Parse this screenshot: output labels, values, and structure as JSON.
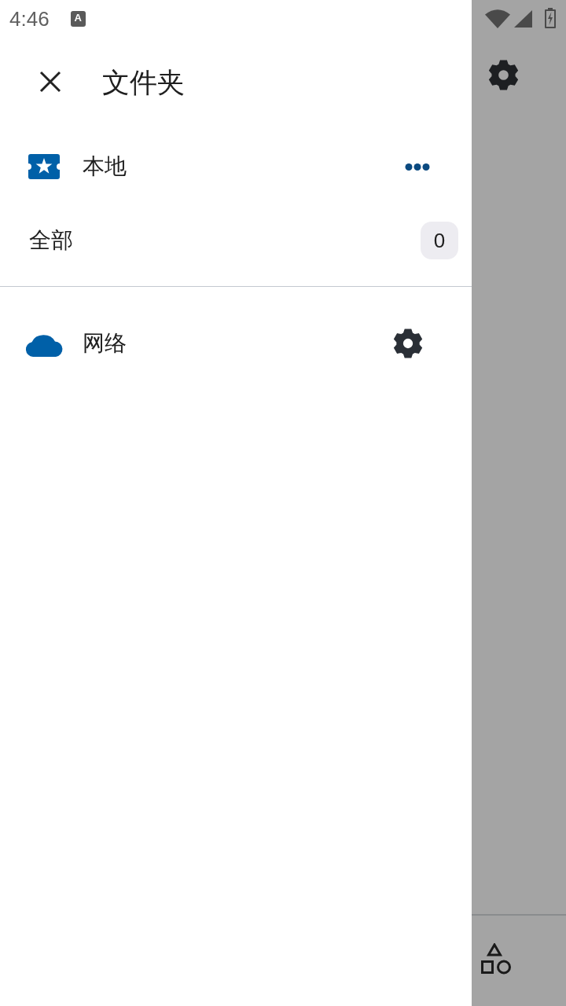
{
  "status_bar": {
    "time": "4:46",
    "notification_glyph": "A"
  },
  "drawer": {
    "title": "文件夹",
    "sections": [
      {
        "kind": "local",
        "label": "本地",
        "items": [
          {
            "label": "全部",
            "count": "0"
          }
        ]
      },
      {
        "kind": "network",
        "label": "网络"
      }
    ]
  }
}
